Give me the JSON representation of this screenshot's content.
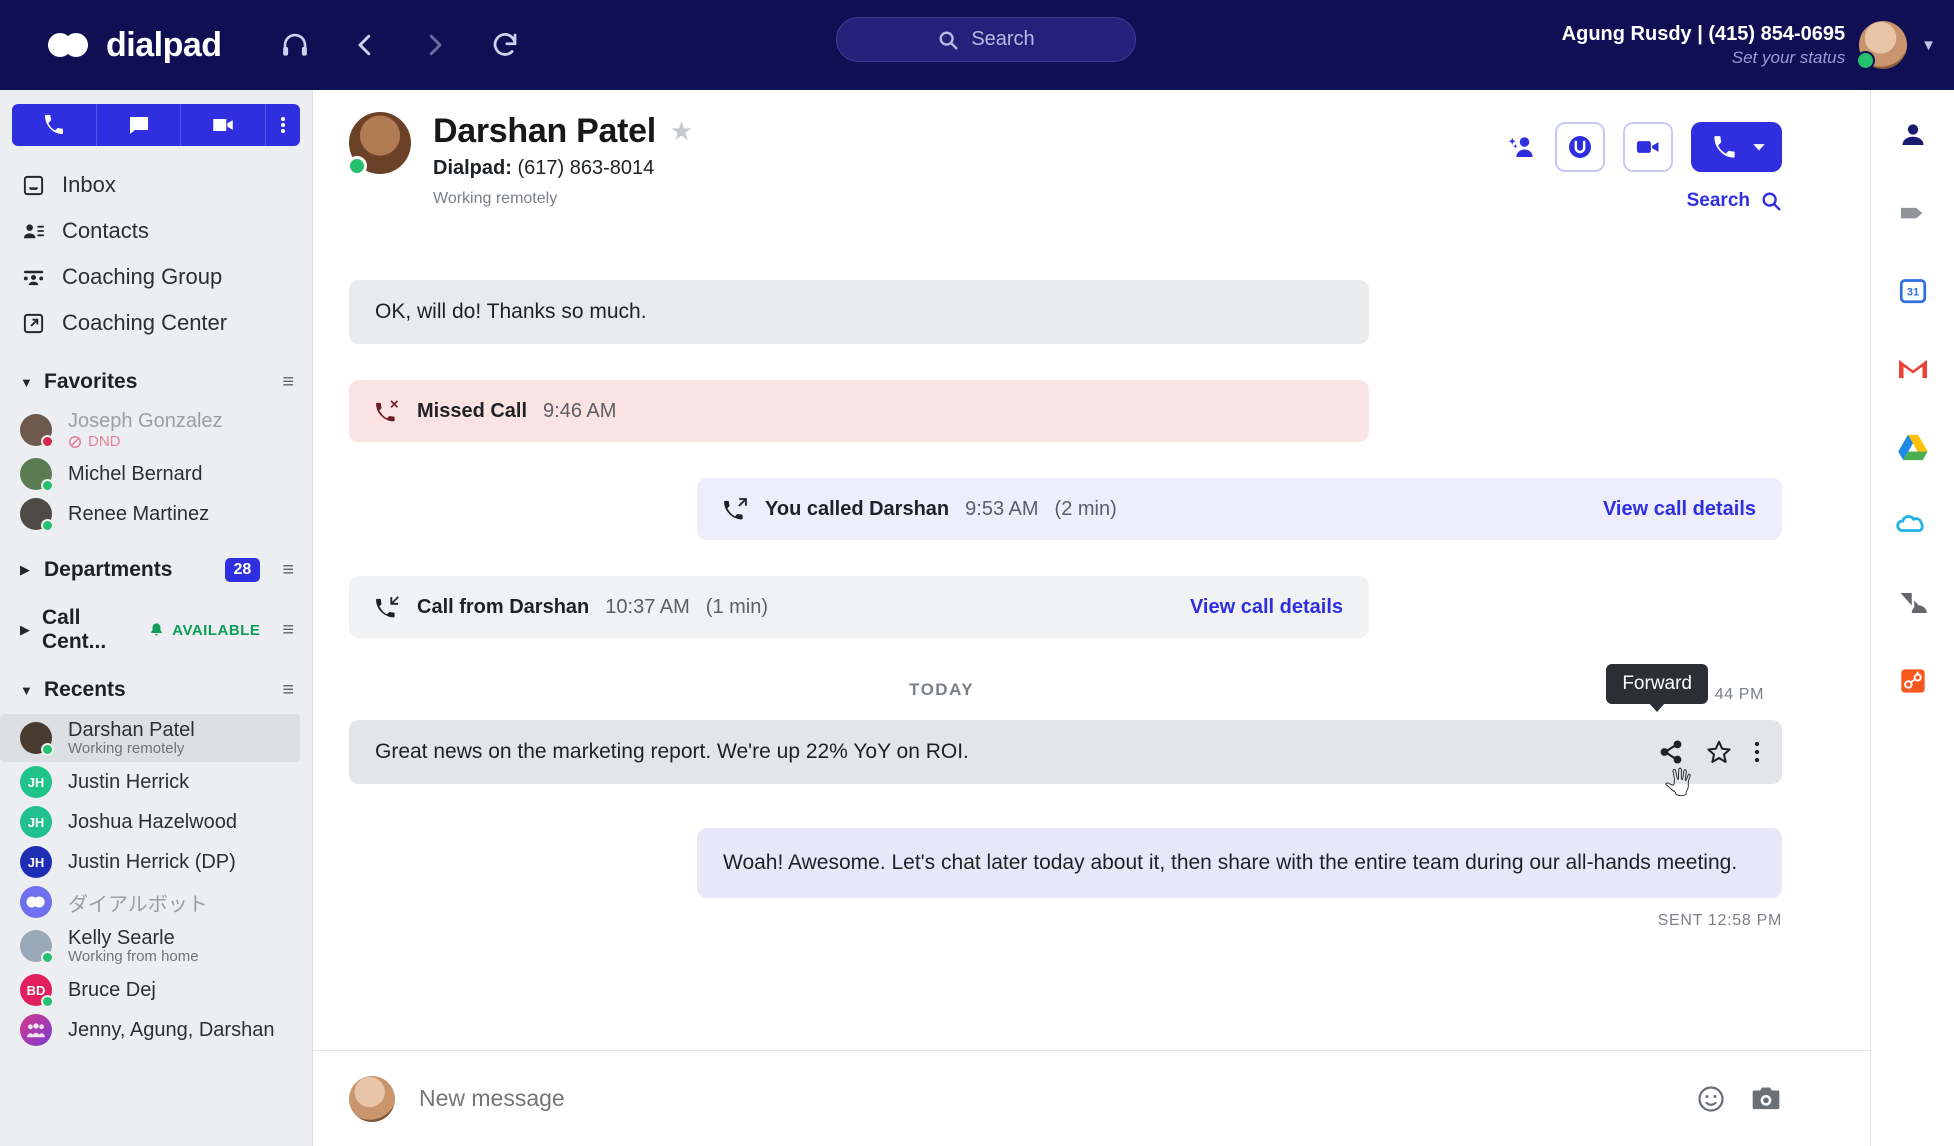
{
  "topbar": {
    "brand": "dialpad",
    "icons": [
      {
        "name": "headset-icon",
        "glyph": "␢"
      },
      {
        "name": "back-arrow-icon",
        "glyph": "‹"
      },
      {
        "name": "forward-arrow-icon",
        "glyph": "›"
      },
      {
        "name": "refresh-icon",
        "glyph": "↻"
      }
    ],
    "search_placeholder": "Search",
    "user_name": "Agung Rusdy | (415) 854-0695",
    "user_status": "Set your status"
  },
  "sidebar": {
    "segments": [
      {
        "name": "phone-tab",
        "icon": "phone-icon"
      },
      {
        "name": "messages-tab",
        "icon": "message-icon"
      },
      {
        "name": "video-tab",
        "icon": "video-icon"
      },
      {
        "name": "more-tab",
        "icon": "kebab-icon"
      }
    ],
    "nav": [
      {
        "label": "Inbox",
        "icon": "inbox-icon"
      },
      {
        "label": "Contacts",
        "icon": "contacts-icon"
      },
      {
        "label": "Coaching Group",
        "icon": "coaching-group-icon"
      },
      {
        "label": "Coaching Center",
        "icon": "coaching-center-icon"
      }
    ],
    "favorites": {
      "title": "Favorites",
      "expanded": true,
      "items": [
        {
          "name": "Joseph Gonzalez",
          "sub": "DND",
          "presence": "dnd",
          "muted": true,
          "avatar_color": "#6d5a4d",
          "initials": ""
        },
        {
          "name": "Michel Bernard",
          "sub": "",
          "presence": "on",
          "muted": false,
          "avatar_color": "#5b7c52",
          "initials": ""
        },
        {
          "name": "Renee Martinez",
          "sub": "",
          "presence": "on",
          "muted": false,
          "avatar_color": "#4e4a46",
          "initials": ""
        }
      ]
    },
    "departments": {
      "title": "Departments",
      "expanded": false,
      "badge": "28"
    },
    "call_center": {
      "title": "Call Cent...",
      "expanded": false,
      "status": "AVAILABLE"
    },
    "recents": {
      "title": "Recents",
      "expanded": true,
      "items": [
        {
          "name": "Darshan Patel",
          "sub": "Working remotely",
          "presence": "on",
          "active": true,
          "avatar_color": "#4a3b30",
          "initials": ""
        },
        {
          "name": "Justin Herrick",
          "sub": "",
          "presence": "",
          "active": false,
          "avatar_color": "#1fc48a",
          "initials": "JH"
        },
        {
          "name": "Joshua Hazelwood",
          "sub": "",
          "presence": "",
          "active": false,
          "avatar_color": "#22c08c",
          "initials": "JH"
        },
        {
          "name": "Justin Herrick (DP)",
          "sub": "",
          "presence": "",
          "active": false,
          "avatar_color": "#1f2db5",
          "initials": "JH"
        },
        {
          "name": "ダイアルボット",
          "sub": "",
          "presence": "",
          "active": false,
          "muted": true,
          "avatar_color": "#6f6ff0",
          "initials": ""
        },
        {
          "name": "Kelly Searle",
          "sub": "Working from home",
          "presence": "on",
          "active": false,
          "avatar_color": "#9aa9b8",
          "initials": ""
        },
        {
          "name": "Bruce Dej",
          "sub": "",
          "presence": "on",
          "active": false,
          "avatar_color": "#e01f5c",
          "initials": "BD"
        },
        {
          "name": "Jenny, Agung, Darshan",
          "sub": "",
          "presence": "",
          "active": false,
          "avatar_color": "#a03bbd",
          "initials": ""
        }
      ]
    }
  },
  "conversation": {
    "contact_name": "Darshan Patel",
    "line_label": "Dialpad:",
    "phone": "(617) 863-8014",
    "presence_note": "Working remotely",
    "search_label": "Search",
    "actions": [
      {
        "name": "add-person-icon"
      },
      {
        "name": "ai-assist-button"
      },
      {
        "name": "video-call-button"
      },
      {
        "name": "call-button"
      }
    ]
  },
  "thread": {
    "messages": [
      {
        "kind": "incoming",
        "text": "OK, will do! Thanks so much."
      },
      {
        "kind": "missed_call",
        "label": "Missed Call",
        "time": "9:46 AM"
      },
      {
        "kind": "outgoing_call",
        "label": "You called Darshan",
        "time": "9:53 AM",
        "duration": "(2 min)",
        "link": "View call details"
      },
      {
        "kind": "incoming_call",
        "label": "Call from Darshan",
        "time": "10:37 AM",
        "duration": "(1 min)",
        "link": "View call details"
      }
    ],
    "day_divider": "TODAY",
    "hover_message": {
      "text": "Great news on the marketing report. We're up 22% YoY on ROI.",
      "time": "44 PM",
      "tooltip": "Forward",
      "tools": [
        {
          "name": "forward-icon"
        },
        {
          "name": "star-icon"
        },
        {
          "name": "more-options-icon"
        }
      ]
    },
    "reply": {
      "text": "Woah! Awesome. Let's chat later today about it, then share with the entire team during our all-hands meeting.",
      "sent_label": "SENT 12:58 PM"
    }
  },
  "composer": {
    "placeholder": "New message",
    "emoji_icon": "emoji-icon",
    "camera_icon": "camera-icon"
  },
  "rail": {
    "items": [
      {
        "name": "contact-panel-icon"
      },
      {
        "name": "tag-icon"
      },
      {
        "name": "google-calendar-icon"
      },
      {
        "name": "gmail-icon"
      },
      {
        "name": "google-drive-icon"
      },
      {
        "name": "salesforce-icon"
      },
      {
        "name": "zendesk-icon"
      },
      {
        "name": "hubspot-icon"
      }
    ]
  },
  "colors": {
    "brand_navy": "#100f54",
    "accent_blue": "#2f2fe0",
    "presence_green": "#25c16f",
    "dnd_red": "#d6254a",
    "missed_call_bg": "#fbe3e3"
  }
}
